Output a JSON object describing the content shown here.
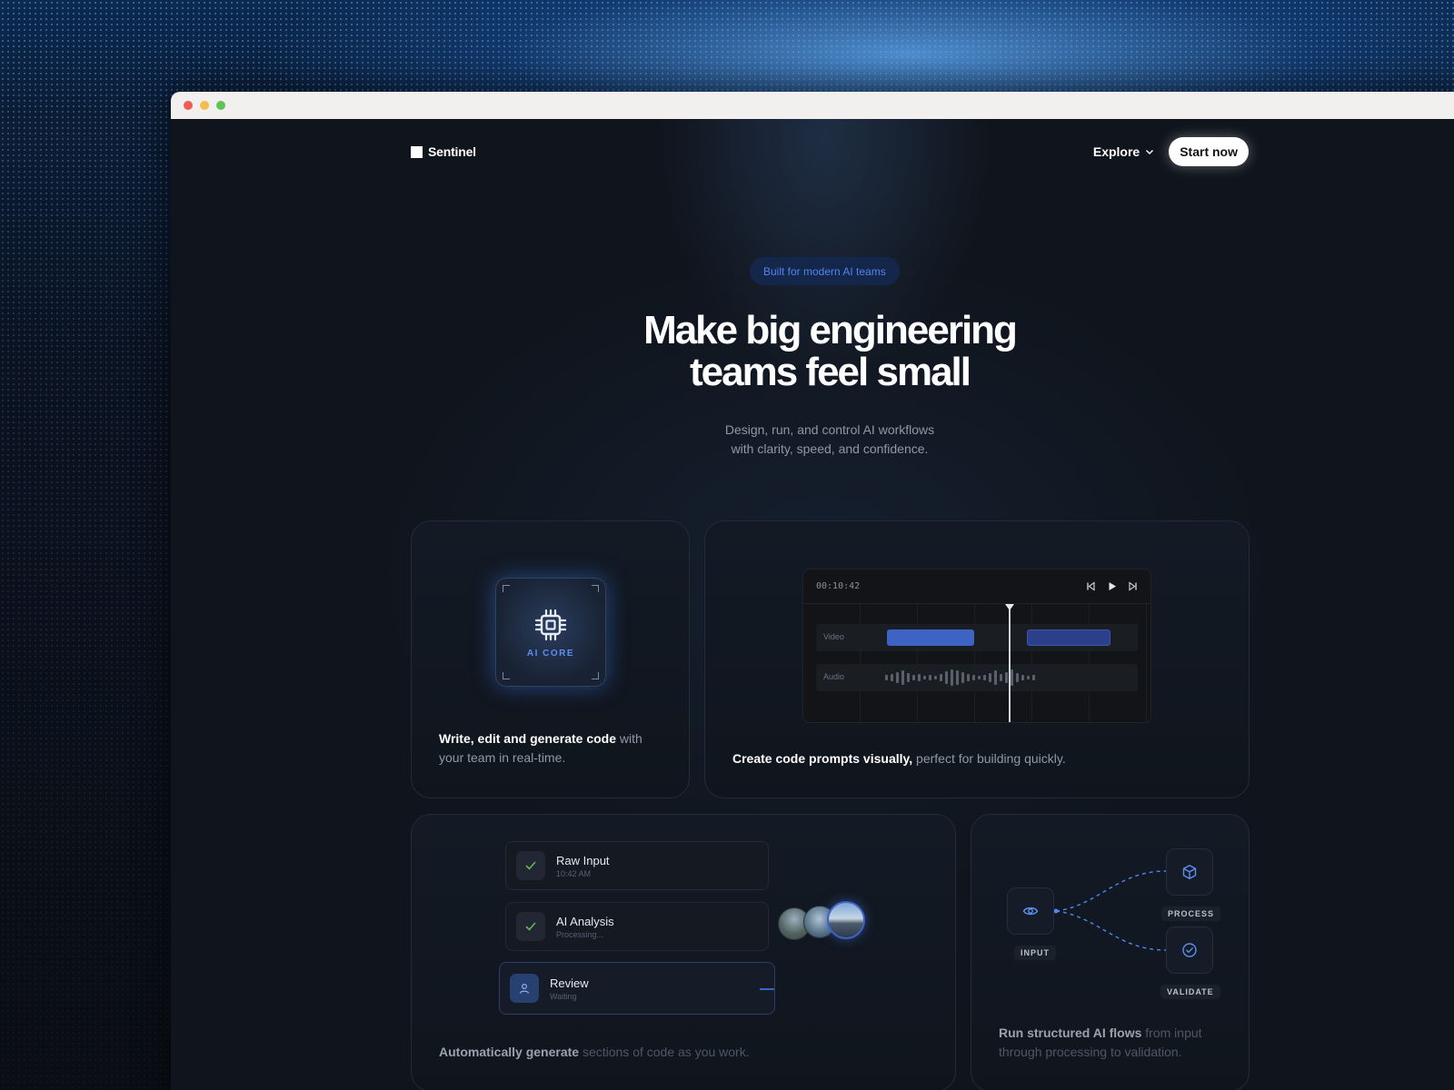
{
  "window": {
    "controls": [
      "close",
      "minimize",
      "maximize"
    ]
  },
  "nav": {
    "brand": "Sentinel",
    "explore_label": "Explore",
    "start_label": "Start now"
  },
  "hero": {
    "badge": "Built for modern AI teams",
    "title_line1": "Make big engineering",
    "title_line2": "teams feel small",
    "subtitle_line1": "Design, run, and control AI workflows",
    "subtitle_line2": "with clarity, speed, and confidence."
  },
  "features": {
    "card1": {
      "chip_label": "AI CORE",
      "text_bold": "Write, edit and generate code",
      "text_rest": " with your team in real-time."
    },
    "card2": {
      "timecode": "00:10:42",
      "video_label": "Video",
      "audio_label": "Audio",
      "text_bold": "Create code prompts visually,",
      "text_rest": " perfect for building quickly."
    },
    "card3": {
      "steps": [
        {
          "title": "Raw Input",
          "sub": "10:42 AM",
          "status": "done"
        },
        {
          "title": "AI Analysis",
          "sub": "Processing...",
          "status": "done"
        },
        {
          "title": "Review",
          "sub": "Waiting",
          "status": "active"
        }
      ],
      "text_bold": "Automatically generate",
      "text_rest": " sections of code as you work."
    },
    "card4": {
      "input_label": "INPUT",
      "process_label": "PROCESS",
      "validate_label": "VALIDATE",
      "text_bold": "Run structured AI flows",
      "text_rest": " from input through processing to validation."
    }
  },
  "colors": {
    "accent": "#4f86f0",
    "badge_bg": "#14264a",
    "clip": "#3d63c4"
  }
}
